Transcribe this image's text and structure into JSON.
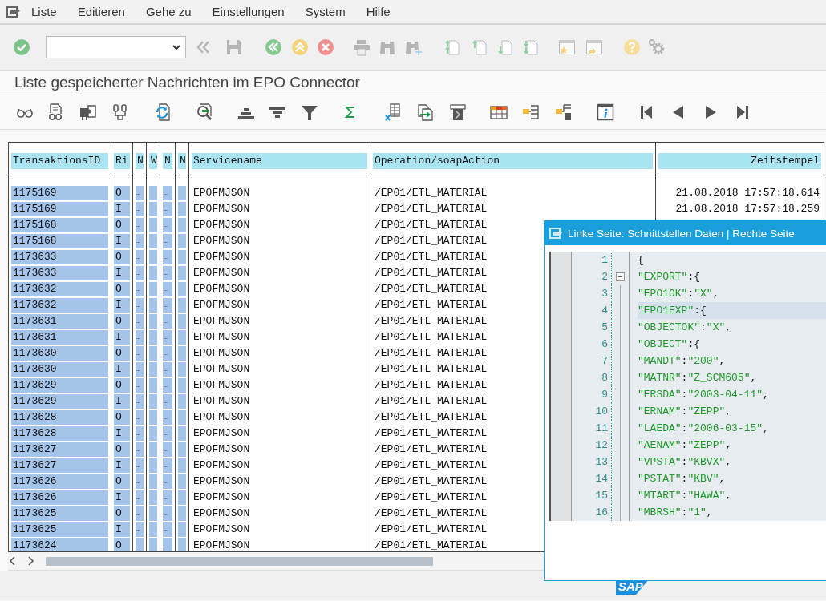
{
  "menu": {
    "items": [
      "Liste",
      "Editieren",
      "Gehe zu",
      "Einstellungen",
      "System",
      "Hilfe"
    ]
  },
  "title": "Liste gespeicherter Nachrichten im EPO Connector",
  "table": {
    "columns": [
      "TransaktionsID",
      "Ri",
      "N",
      "W",
      "N",
      "N",
      "Servicename",
      "Operation/soapAction",
      "Zeitstempel"
    ],
    "rows": [
      {
        "id": "1175169",
        "ri": "O",
        "n1": "…",
        "n3": "…",
        "service": "EPOFMJSON",
        "operation": "/EP01/ETL_MATERIAL",
        "timestamp": "21.08.2018 17:57:18.614"
      },
      {
        "id": "1175169",
        "ri": "I",
        "n1": "…",
        "n3": "…",
        "service": "EPOFMJSON",
        "operation": "/EP01/ETL_MATERIAL",
        "timestamp": "21.08.2018 17:57:18.259"
      },
      {
        "id": "1175168",
        "ri": "O",
        "n1": "…",
        "n3": "…",
        "service": "EPOFMJSON",
        "operation": "/EP01/ETL_MATERIAL"
      },
      {
        "id": "1175168",
        "ri": "I",
        "n1": "…",
        "n3": "…",
        "service": "EPOFMJSON",
        "operation": "/EP01/ETL_MATERIAL"
      },
      {
        "id": "1173633",
        "ri": "O",
        "n1": "…",
        "n3": "…",
        "service": "EPOFMJSON",
        "operation": "/EP01/ETL_MATERIAL"
      },
      {
        "id": "1173633",
        "ri": "I",
        "n1": "…",
        "n3": "…",
        "service": "EPOFMJSON",
        "operation": "/EP01/ETL_MATERIAL"
      },
      {
        "id": "1173632",
        "ri": "O",
        "n1": "…",
        "n3": "…",
        "service": "EPOFMJSON",
        "operation": "/EP01/ETL_MATERIAL"
      },
      {
        "id": "1173632",
        "ri": "I",
        "n1": "…",
        "n3": "…",
        "service": "EPOFMJSON",
        "operation": "/EP01/ETL_MATERIAL"
      },
      {
        "id": "1173631",
        "ri": "O",
        "n1": "…",
        "n3": "…",
        "service": "EPOFMJSON",
        "operation": "/EP01/ETL_MATERIAL"
      },
      {
        "id": "1173631",
        "ri": "I",
        "n1": "…",
        "n3": "…",
        "service": "EPOFMJSON",
        "operation": "/EP01/ETL_MATERIAL"
      },
      {
        "id": "1173630",
        "ri": "O",
        "n1": "…",
        "n3": "…",
        "service": "EPOFMJSON",
        "operation": "/EP01/ETL_MATERIAL"
      },
      {
        "id": "1173630",
        "ri": "I",
        "n1": "…",
        "n3": "…",
        "service": "EPOFMJSON",
        "operation": "/EP01/ETL_MATERIAL"
      },
      {
        "id": "1173629",
        "ri": "O",
        "n1": "…",
        "n3": "…",
        "service": "EPOFMJSON",
        "operation": "/EP01/ETL_MATERIAL"
      },
      {
        "id": "1173629",
        "ri": "I",
        "n1": "…",
        "n3": "…",
        "service": "EPOFMJSON",
        "operation": "/EP01/ETL_MATERIAL"
      },
      {
        "id": "1173628",
        "ri": "O",
        "n1": "…",
        "n3": "…",
        "service": "EPOFMJSON",
        "operation": "/EP01/ETL_MATERIAL"
      },
      {
        "id": "1173628",
        "ri": "I",
        "n1": "…",
        "n3": "…",
        "service": "EPOFMJSON",
        "operation": "/EP01/ETL_MATERIAL"
      },
      {
        "id": "1173627",
        "ri": "O",
        "n1": "…",
        "n3": "…",
        "service": "EPOFMJSON",
        "operation": "/EP01/ETL_MATERIAL"
      },
      {
        "id": "1173627",
        "ri": "I",
        "n1": "…",
        "n3": "…",
        "service": "EPOFMJSON",
        "operation": "/EP01/ETL_MATERIAL"
      },
      {
        "id": "1173626",
        "ri": "O",
        "n1": "…",
        "n3": "…",
        "service": "EPOFMJSON",
        "operation": "/EP01/ETL_MATERIAL"
      },
      {
        "id": "1173626",
        "ri": "I",
        "n1": "…",
        "n3": "…",
        "service": "EPOFMJSON",
        "operation": "/EP01/ETL_MATERIAL"
      },
      {
        "id": "1173625",
        "ri": "O",
        "n1": "…",
        "n3": "…",
        "service": "EPOFMJSON",
        "operation": "/EP01/ETL_MATERIAL"
      },
      {
        "id": "1173625",
        "ri": "I",
        "n1": "…",
        "n3": "…",
        "service": "EPOFMJSON",
        "operation": "/EP01/ETL_MATERIAL"
      },
      {
        "id": "1173624",
        "ri": "O",
        "n1": "…",
        "n3": "…",
        "service": "EPOFMJSON",
        "operation": "/EP01/ETL_MATERIAL"
      }
    ]
  },
  "popup": {
    "title": "Linke Seite: Schnittstellen Daten | Rechte Seite",
    "lines": [
      {
        "number": "1",
        "text": "{",
        "collapsible": false,
        "current": false
      },
      {
        "number": "2",
        "text": "\"EXPORT\":{",
        "collapsible": true,
        "current": false
      },
      {
        "number": "3",
        "text": "\"EPO1OK\":\"X\",",
        "collapsible": false,
        "current": false
      },
      {
        "number": "4",
        "text": "\"EPO1EXP\":{",
        "collapsible": false,
        "current": true
      },
      {
        "number": "5",
        "text": "\"OBJECTOK\":\"X\",",
        "collapsible": false,
        "current": false
      },
      {
        "number": "6",
        "text": "\"OBJECT\":{",
        "collapsible": false,
        "current": false
      },
      {
        "number": "7",
        "text": "\"MANDT\":\"200\",",
        "collapsible": false,
        "current": false
      },
      {
        "number": "8",
        "text": "\"MATNR\":\"Z_SCM605\",",
        "collapsible": false,
        "current": false
      },
      {
        "number": "9",
        "text": "\"ERSDA\":\"2003-04-11\",",
        "collapsible": false,
        "current": false
      },
      {
        "number": "10",
        "text": "\"ERNAM\":\"ZEPP\",",
        "collapsible": false,
        "current": false
      },
      {
        "number": "11",
        "text": "\"LAEDA\":\"2006-03-15\",",
        "collapsible": false,
        "current": false
      },
      {
        "number": "12",
        "text": "\"AENAM\":\"ZEPP\",",
        "collapsible": false,
        "current": false
      },
      {
        "number": "13",
        "text": "\"VPSTA\":\"KBVX\",",
        "collapsible": false,
        "current": false
      },
      {
        "number": "14",
        "text": "\"PSTAT\":\"KBV\",",
        "collapsible": false,
        "current": false
      },
      {
        "number": "15",
        "text": "\"MTART\":\"HAWA\",",
        "collapsible": false,
        "current": false
      },
      {
        "number": "16",
        "text": "\"MBRSH\":\"1\",",
        "collapsible": false,
        "current": false
      }
    ]
  },
  "logo": "SAP"
}
